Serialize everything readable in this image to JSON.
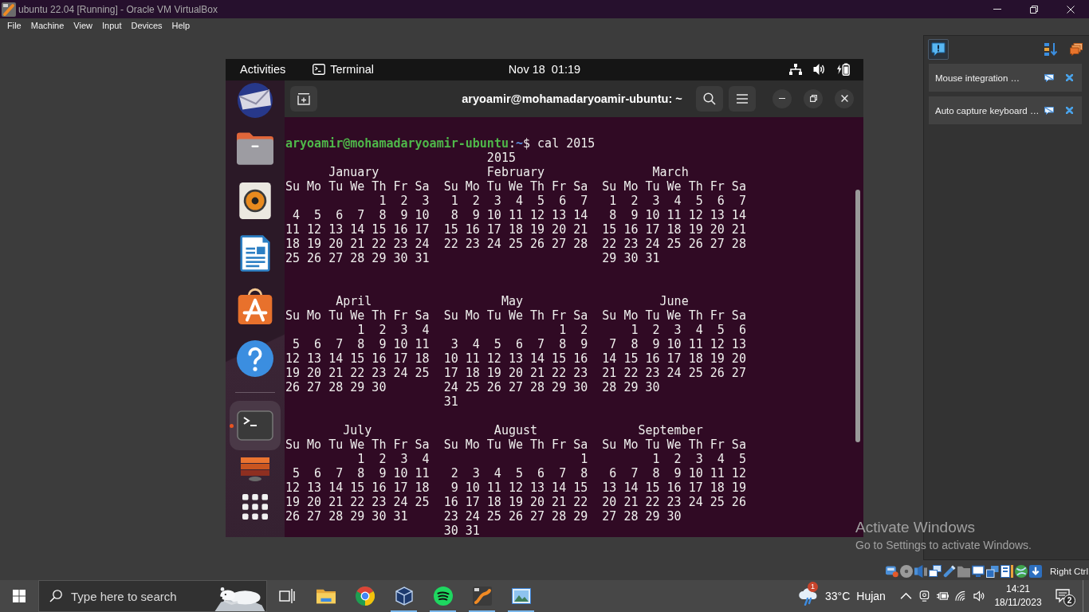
{
  "window": {
    "title": "ubuntu 22.04 [Running] - Oracle VM VirtualBox"
  },
  "menu_bar": [
    "File",
    "Machine",
    "View",
    "Input",
    "Devices",
    "Help"
  ],
  "vm": {
    "top_bar": {
      "activities": "Activities",
      "app_menu": "Terminal",
      "clock": "Nov 18  01:19"
    },
    "dock": {
      "favorites": [
        {
          "kind": "mail",
          "running": false,
          "focused": false
        },
        {
          "kind": "files",
          "running": false,
          "focused": false
        },
        {
          "kind": "music",
          "running": false,
          "focused": false
        },
        {
          "kind": "writer",
          "running": false,
          "focused": false
        },
        {
          "kind": "store",
          "running": false,
          "focused": false
        },
        {
          "kind": "help",
          "running": false,
          "focused": false
        }
      ],
      "others": [
        {
          "kind": "terminal",
          "running": true,
          "focused": true
        },
        {
          "kind": "stack",
          "running": false,
          "focused": false
        }
      ]
    },
    "terminal": {
      "title": "aryoamir@mohamadaryoamir-ubuntu: ~",
      "prompt": {
        "user_host": "aryoamir@mohamadaryoamir-ubuntu",
        "separator": ":",
        "path": "~",
        "symbol": "$",
        "command": "cal 2015"
      },
      "calendar": {
        "year": "2015",
        "months": [
          {
            "name": "January",
            "weekdays": "Su Mo Tu We Th Fr Sa",
            "weeks": [
              "1  2  3",
              "4  5  6  7  8  9 10",
              "11 12 13 14 15 16 17",
              "18 19 20 21 22 23 24",
              "25 26 27 28 29 30 31"
            ]
          },
          {
            "name": "February",
            "weekdays": "Su Mo Tu We Th Fr Sa",
            "weeks": [
              "1  2  3  4  5  6  7",
              "8  9 10 11 12 13 14",
              "15 16 17 18 19 20 21",
              "22 23 24 25 26 27 28"
            ]
          },
          {
            "name": "March",
            "weekdays": "Su Mo Tu We Th Fr Sa",
            "weeks": [
              "1  2  3  4  5  6  7",
              "8  9 10 11 12 13 14",
              "15 16 17 18 19 20 21",
              "22 23 24 25 26 27 28",
              "29 30 31"
            ]
          },
          {
            "name": "April",
            "weekdays": "Su Mo Tu We Th Fr Sa",
            "weeks": [
              "1  2  3  4",
              "5  6  7  8  9 10 11",
              "12 13 14 15 16 17 18",
              "19 20 21 22 23 24 25",
              "26 27 28 29 30"
            ]
          },
          {
            "name": "May",
            "weekdays": "Su Mo Tu We Th Fr Sa",
            "weeks": [
              "1  2",
              "3  4  5  6  7  8  9",
              "10 11 12 13 14 15 16",
              "17 18 19 20 21 22 23",
              "24 25 26 27 28 29 30",
              "31"
            ]
          },
          {
            "name": "June",
            "weekdays": "Su Mo Tu We Th Fr Sa",
            "weeks": [
              "1  2  3  4  5  6",
              "7  8  9 10 11 12 13",
              "14 15 16 17 18 19 20",
              "21 22 23 24 25 26 27",
              "28 29 30"
            ]
          },
          {
            "name": "July",
            "weekdays": "Su Mo Tu We Th Fr Sa",
            "weeks": [
              "1  2  3  4",
              "5  6  7  8  9 10 11",
              "12 13 14 15 16 17 18",
              "19 20 21 22 23 24 25",
              "26 27 28 29 30 31"
            ]
          },
          {
            "name": "August",
            "weekdays": "Su Mo Tu We Th Fr Sa",
            "weeks": [
              "1",
              "2  3  4  5  6  7  8",
              "9 10 11 12 13 14 15",
              "16 17 18 19 20 21 22",
              "23 24 25 26 27 28 29",
              "30 31"
            ]
          },
          {
            "name": "September",
            "weekdays": "Su Mo Tu We Th Fr Sa",
            "weeks": [
              "1  2  3  4  5",
              "6  7  8  9 10 11 12",
              "13 14 15 16 17 18 19",
              "20 21 22 23 24 25 26",
              "27 28 29 30"
            ]
          }
        ]
      }
    }
  },
  "notifications": [
    {
      "text": "Mouse integration …"
    },
    {
      "text": "Auto capture keyboard …"
    }
  ],
  "status_bar": {
    "host_key": "Right Ctrl"
  },
  "activation": {
    "title": "Activate Windows",
    "message": "Go to Settings to activate Windows."
  },
  "taskbar": {
    "search": {
      "placeholder": "Type here to search"
    },
    "apps": [
      {
        "kind": "files",
        "running": false
      },
      {
        "kind": "browser",
        "running": false
      },
      {
        "kind": "vm",
        "running": true
      },
      {
        "kind": "music",
        "running": true
      },
      {
        "kind": "swirl",
        "running": true
      },
      {
        "kind": "photos",
        "running": true
      }
    ],
    "weather": {
      "badge": "1",
      "temperature": "33°C",
      "condition": "Hujan"
    },
    "time": "14:21",
    "date": "18/11/2023",
    "notification_count": "2"
  }
}
